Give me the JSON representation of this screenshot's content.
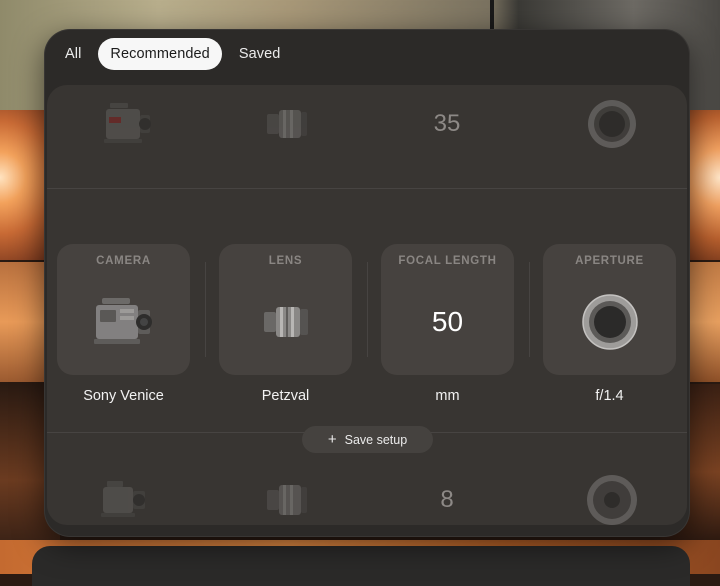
{
  "tabs": [
    {
      "label": "All",
      "active": false
    },
    {
      "label": "Recommended",
      "active": true
    },
    {
      "label": "Saved",
      "active": false
    }
  ],
  "picker": {
    "row_above": {
      "camera_icon": "cinema-camera-icon",
      "lens_icon": "lens-icon",
      "focal_length": "35",
      "aperture_icon": "aperture-ring-icon"
    },
    "row_selected": {
      "camera": {
        "header": "CAMERA",
        "value": "Sony Venice",
        "icon": "sony-venice-camera-icon"
      },
      "lens": {
        "header": "LENS",
        "value": "Petzval",
        "icon": "lens-icon"
      },
      "focal_length": {
        "header": "FOCAL LENGTH",
        "number": "50",
        "value": "mm"
      },
      "aperture": {
        "header": "APERTURE",
        "value": "f/1.4",
        "icon": "aperture-ring-icon"
      }
    },
    "row_below": {
      "camera_icon": "cinema-camera-icon",
      "lens_icon": "lens-icon",
      "focal_length": "8",
      "aperture_icon": "aperture-ring-icon"
    }
  },
  "save_button": {
    "label": "Save setup",
    "icon": "plus-icon"
  },
  "colors": {
    "panel": "#2c2a28",
    "picker": "#383532",
    "card": "#46423f",
    "active_tab": "#f7f7f7"
  }
}
